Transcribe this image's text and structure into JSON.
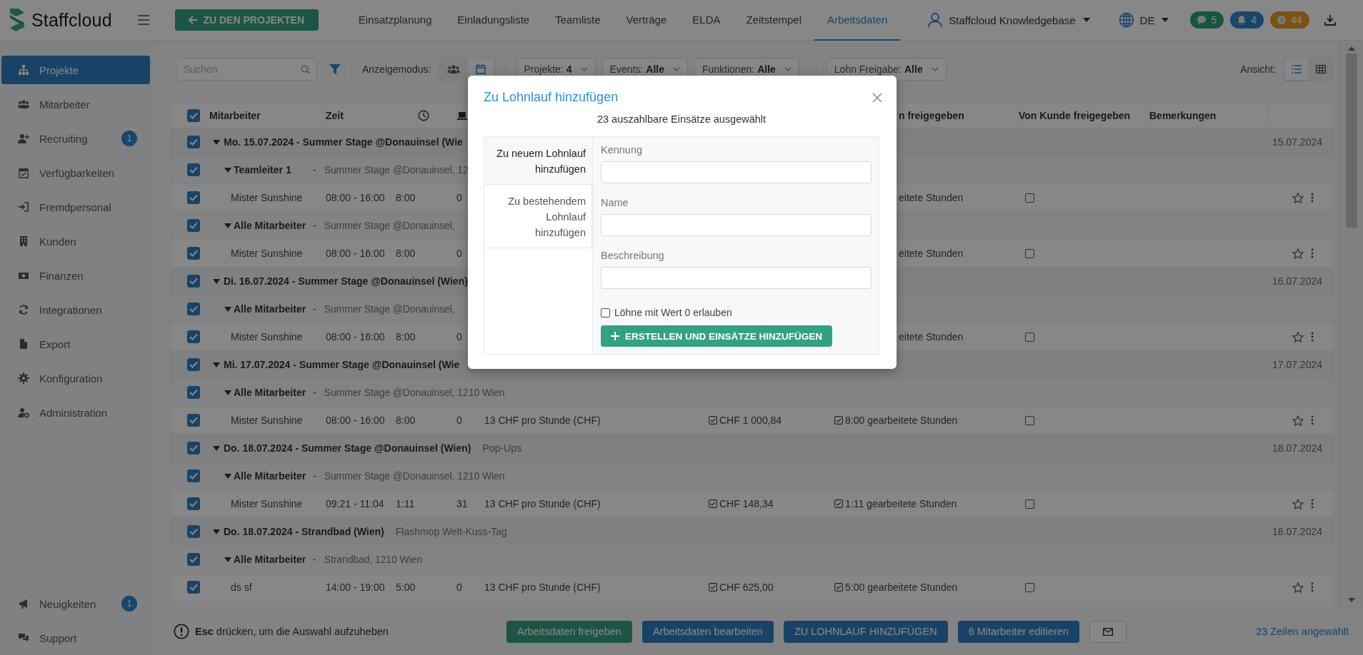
{
  "brand": {
    "name": "Staffcloud"
  },
  "back_button": "ZU DEN PROJEKTEN",
  "nav_tabs": [
    {
      "label": "Einsatzplanung",
      "selected": false
    },
    {
      "label": "Einladungsliste",
      "selected": false
    },
    {
      "label": "Teamliste",
      "selected": false
    },
    {
      "label": "Verträge",
      "selected": false
    },
    {
      "label": "ELDA",
      "selected": false
    },
    {
      "label": "Zeitstempel",
      "selected": false
    },
    {
      "label": "Arbeitsdaten",
      "selected": true
    }
  ],
  "account": "Staffcloud Knowledgebase",
  "language": "DE",
  "counters": [
    {
      "kind": "messages",
      "count": "5",
      "color": "#185442"
    },
    {
      "kind": "notifications",
      "count": "4",
      "color": "#19466a"
    },
    {
      "kind": "timers",
      "count": "44",
      "color": "#795216"
    }
  ],
  "sidebar": {
    "items": [
      {
        "label": "Projekte",
        "selected": true
      },
      {
        "label": "Mitarbeiter",
        "selected": false
      },
      {
        "label": "Recruiting",
        "selected": false,
        "badge": "1"
      },
      {
        "label": "Verfügbarkeiten",
        "selected": false
      },
      {
        "label": "Fremdpersonal",
        "selected": false
      },
      {
        "label": "Kunden",
        "selected": false
      },
      {
        "label": "Finanzen",
        "selected": false
      },
      {
        "label": "Integrationen",
        "selected": false
      },
      {
        "label": "Export",
        "selected": false
      },
      {
        "label": "Konfiguration",
        "selected": false
      },
      {
        "label": "Administration",
        "selected": false
      }
    ],
    "bottom_items": [
      {
        "label": "Neuigkeiten",
        "badge": "1"
      },
      {
        "label": "Support"
      }
    ]
  },
  "toolbar": {
    "search": {
      "placeholder": "Suchen"
    },
    "mode_label": "Anzeigemodus:",
    "modes": [
      {
        "kind": "people",
        "selected": false
      },
      {
        "kind": "calendar",
        "selected": true
      }
    ],
    "filters": [
      {
        "label": "Projekte:",
        "value": "4"
      },
      {
        "label": "Events:",
        "value": "Alle"
      },
      {
        "label": "Funktionen:",
        "value": "Alle"
      },
      {
        "label": "Lohn Freigabe:",
        "value": "Alle"
      }
    ],
    "view_label": "Ansicht:",
    "views": [
      {
        "kind": "list",
        "selected": true
      },
      {
        "kind": "grid",
        "selected": false
      }
    ]
  },
  "table": {
    "all_checked": true,
    "columns": [
      {
        "kind": "text",
        "label": "Mitarbeiter"
      },
      {
        "kind": "text",
        "label": "Zeit"
      },
      {
        "kind": "clock"
      },
      {
        "kind": "laptop"
      },
      {
        "kind": "text",
        "label": "n freigegeben"
      },
      {
        "kind": "text",
        "label": "Von Kunde freigegeben"
      },
      {
        "kind": "text",
        "label": "Bemerkungen"
      }
    ],
    "rows": [
      {
        "kind": "date",
        "checked": true,
        "expanded": true,
        "label": "Mo. 15.07.2024 - Summer Stage @Donauinsel (Wie",
        "date": "15.07.2024"
      },
      {
        "kind": "group",
        "checked": true,
        "expanded": true,
        "label": "Teamleiter 1",
        "separator": "-",
        "location": "Summer Stage @Donauinsel, 12"
      },
      {
        "kind": "employee",
        "checked": true,
        "name": "Mister Sunshine",
        "time": "08:00 - 16:00",
        "hours": "8:00",
        "pause": "0",
        "worked": "eitete Stunden",
        "customer_approved": false,
        "favorite": false
      },
      {
        "kind": "group",
        "checked": true,
        "expanded": true,
        "label": "Alle Mitarbeiter",
        "separator": "-",
        "location": "Summer Stage @Donauinsel,"
      },
      {
        "kind": "employee",
        "checked": true,
        "name": "Mister Sunshine",
        "time": "08:00 - 16:00",
        "hours": "8:00",
        "pause": "0",
        "worked": "eitete Stunden",
        "customer_approved": false,
        "favorite": false
      },
      {
        "kind": "date",
        "checked": true,
        "expanded": true,
        "label": "Di. 16.07.2024 - Summer Stage @Donauinsel (Wien)",
        "date": "16.07.2024"
      },
      {
        "kind": "group",
        "checked": true,
        "expanded": true,
        "label": "Alle Mitarbeiter",
        "separator": "-",
        "location": "Summer Stage @Donauinsel,"
      },
      {
        "kind": "employee",
        "checked": true,
        "name": "Mister Sunshine",
        "time": "08:00 - 16:00",
        "hours": "8:00",
        "pause": "0",
        "worked": "eitete Stunden",
        "customer_approved": false,
        "favorite": false
      },
      {
        "kind": "date",
        "checked": true,
        "expanded": true,
        "label": "Mi. 17.07.2024 - Summer Stage @Donauinsel (Wie",
        "date": "17.07.2024"
      },
      {
        "kind": "group",
        "checked": true,
        "expanded": true,
        "label": "Alle Mitarbeiter",
        "separator": "-",
        "location": "Summer Stage @Donauinsel, 1210 Wien"
      },
      {
        "kind": "employee",
        "checked": true,
        "name": "Mister Sunshine",
        "time": "08:00 - 16:00",
        "hours": "8:00",
        "pause": "0",
        "rate": "13 CHF pro Stunde (CHF)",
        "amount": "CHF 1 000,84",
        "amount_approved": true,
        "worked": "8:00 gearbeitete Stunden",
        "worked_approved": true,
        "customer_approved": false,
        "favorite": false
      },
      {
        "kind": "date",
        "checked": true,
        "expanded": true,
        "label": "Do. 18.07.2024 - Summer Stage @Donauinsel (Wien)",
        "event": "Pop-Ups",
        "date": "18.07.2024"
      },
      {
        "kind": "group",
        "checked": true,
        "expanded": true,
        "label": "Alle Mitarbeiter",
        "separator": "-",
        "location": "Summer Stage @Donauinsel, 1210 Wien"
      },
      {
        "kind": "employee",
        "checked": true,
        "name": "Mister Sunshine",
        "time": "09:21 - 11:04",
        "hours": "1:11",
        "pause": "31",
        "rate": "13 CHF pro Stunde (CHF)",
        "amount": "CHF 148,34",
        "amount_approved": true,
        "worked": "1:11 gearbeitete Stunden",
        "worked_approved": true,
        "customer_approved": false,
        "favorite": false
      },
      {
        "kind": "date",
        "checked": true,
        "expanded": true,
        "label": "Do. 18.07.2024 - Strandbad (Wien)",
        "event": "Flashmop Welt-Kuss-Tag",
        "date": "18.07.2024"
      },
      {
        "kind": "group",
        "checked": true,
        "expanded": true,
        "label": "Alle Mitarbeiter",
        "separator": "-",
        "location": "Strandbad, 1210 Wien"
      },
      {
        "kind": "employee",
        "checked": true,
        "name": "ds sf",
        "time": "14:00 - 19:00",
        "hours": "5:00",
        "pause": "0",
        "rate": "13 CHF pro Stunde (CHF)",
        "amount": "CHF 625,00",
        "amount_approved": true,
        "worked": "5:00 gearbeitete Stunden",
        "worked_approved": true,
        "customer_approved": false,
        "favorite": false
      }
    ]
  },
  "footer": {
    "hint": "**Esc** drücken, um die Auswahl aufzuheben",
    "actions": [
      {
        "kind": "success",
        "label": "Arbeitsdaten freigeben"
      },
      {
        "kind": "primary",
        "label": "Arbeitsdaten bearbeiten"
      },
      {
        "kind": "primary",
        "label": "ZU LOHNLAUF HINZUFÜGEN"
      },
      {
        "kind": "primary",
        "label": "6 Mitarbeiter editieren"
      },
      {
        "kind": "mail"
      }
    ],
    "selection_count": "23 Zeilen angewählt"
  },
  "modal": {
    "title": "Zu Lohnlauf hinzufügen",
    "subtitle": "23 auszahlbare Einsätze ausgewählt",
    "tabs": [
      {
        "label": "Zu neuem Lohnlauf hinzufügen",
        "selected": true
      },
      {
        "label": "Zu bestehendem Lohnlauf hinzufügen",
        "selected": false
      }
    ],
    "fields": [
      {
        "label": "Kennung"
      },
      {
        "label": "Name"
      },
      {
        "label": "Beschreibung"
      }
    ],
    "allow_zero": {
      "label": "Löhne mit Wert 0 erlauben",
      "checked": false
    },
    "submit": "ERSTELLEN UND EINSÄTZE HINZUFÜGEN"
  }
}
